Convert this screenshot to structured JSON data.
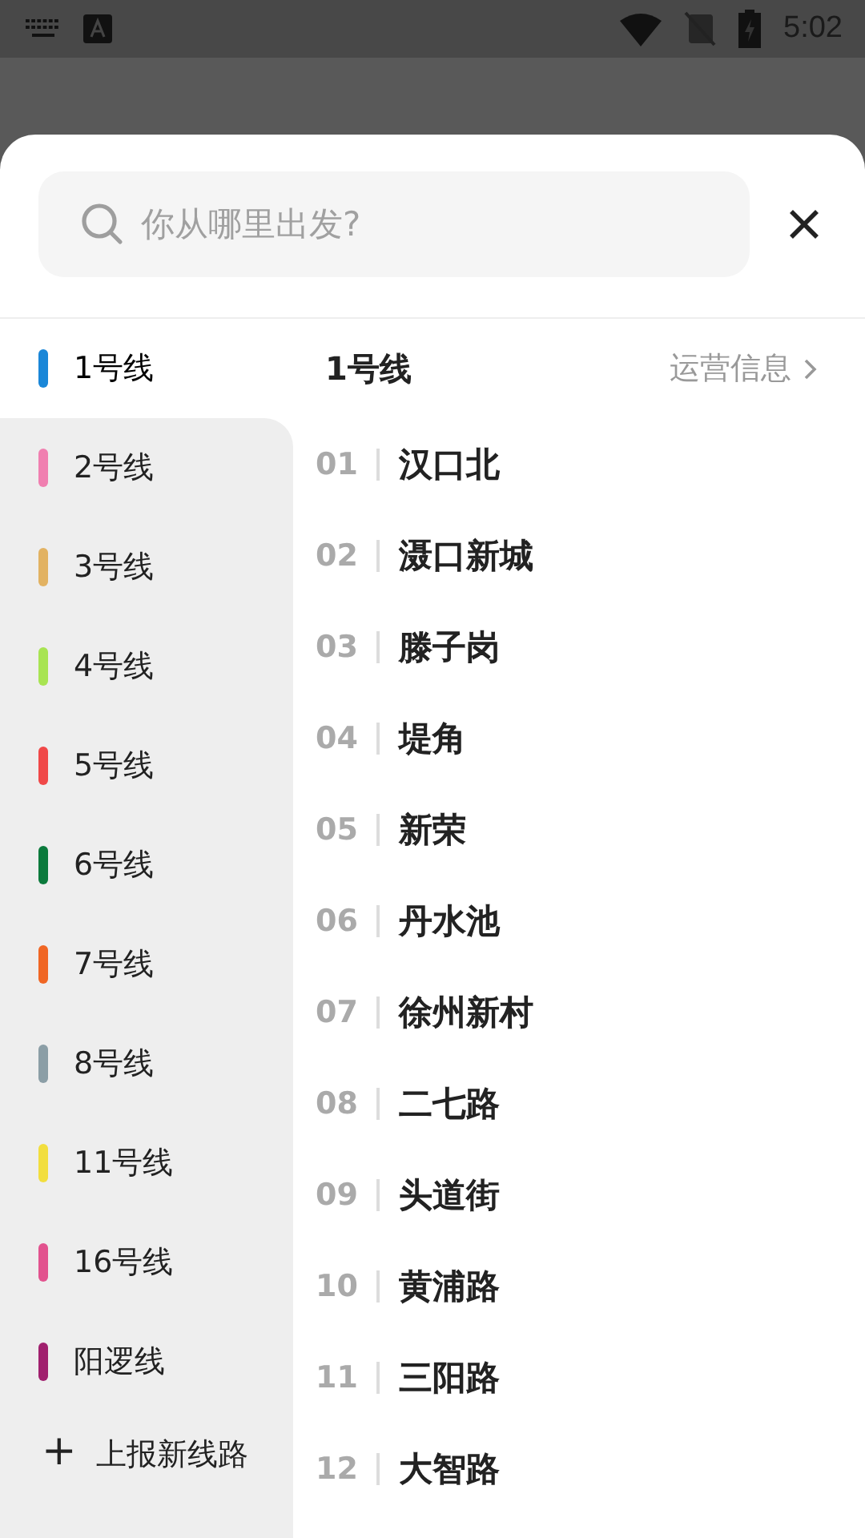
{
  "status_bar": {
    "time": "5:02"
  },
  "search": {
    "placeholder": "你从哪里出发?"
  },
  "lines": [
    {
      "name": "1号线",
      "color": "#1a87d8",
      "selected": true
    },
    {
      "name": "2号线",
      "color": "#f07fb0",
      "selected": false
    },
    {
      "name": "3号线",
      "color": "#e2b262",
      "selected": false
    },
    {
      "name": "4号线",
      "color": "#a8e452",
      "selected": false
    },
    {
      "name": "5号线",
      "color": "#f04848",
      "selected": false
    },
    {
      "name": "6号线",
      "color": "#0b7a3c",
      "selected": false
    },
    {
      "name": "7号线",
      "color": "#f06624",
      "selected": false
    },
    {
      "name": "8号线",
      "color": "#8b9ea6",
      "selected": false
    },
    {
      "name": "11号线",
      "color": "#f2de3e",
      "selected": false
    },
    {
      "name": "16号线",
      "color": "#e2528e",
      "selected": false
    },
    {
      "name": "阳逻线",
      "color": "#a0206e",
      "selected": false
    }
  ],
  "report_line": {
    "icon": "+",
    "label": "上报新线路"
  },
  "detail": {
    "title": "1号线",
    "info_link": "运营信息",
    "stations": [
      {
        "number": "01",
        "name": "汉口北"
      },
      {
        "number": "02",
        "name": "滠口新城"
      },
      {
        "number": "03",
        "name": "滕子岗"
      },
      {
        "number": "04",
        "name": "堤角"
      },
      {
        "number": "05",
        "name": "新荣"
      },
      {
        "number": "06",
        "name": "丹水池"
      },
      {
        "number": "07",
        "name": "徐州新村"
      },
      {
        "number": "08",
        "name": "二七路"
      },
      {
        "number": "09",
        "name": "头道街"
      },
      {
        "number": "10",
        "name": "黄浦路"
      },
      {
        "number": "11",
        "name": "三阳路"
      },
      {
        "number": "12",
        "name": "大智路"
      }
    ]
  }
}
